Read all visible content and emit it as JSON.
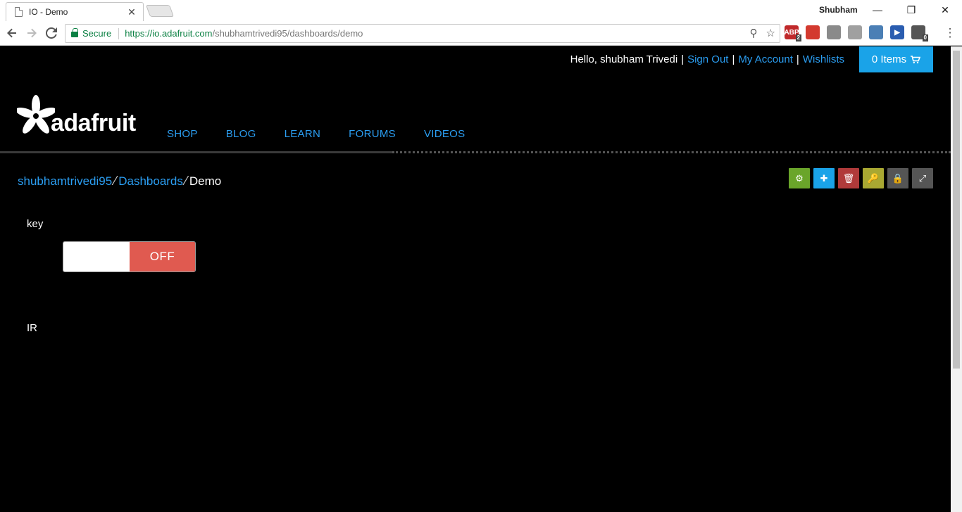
{
  "browser": {
    "tab_title": "IO - Demo",
    "tab_close": "✕",
    "profile_name": "Shubham",
    "minimize": "—",
    "restore": "❐",
    "close": "✕",
    "secure_label": "Secure",
    "url_host": "https://io.adafruit.com",
    "url_path": "/shubhamtrivedi95/dashboards/demo",
    "extensions": [
      {
        "name": "abp",
        "label": "ABP",
        "badge": "2",
        "color": "#c0282a"
      },
      {
        "name": "book",
        "label": "",
        "badge": "",
        "color": "#d33a2f"
      },
      {
        "name": "copy",
        "label": "",
        "badge": "",
        "color": "#8a8a8a"
      },
      {
        "name": "pdf",
        "label": "",
        "badge": "",
        "color": "#a0a0a0"
      },
      {
        "name": "photo",
        "label": "",
        "badge": "",
        "color": "#4b7fb5"
      },
      {
        "name": "play",
        "label": "▶",
        "badge": "",
        "color": "#2a5db0"
      },
      {
        "name": "trash",
        "label": "",
        "badge": "0",
        "color": "#555555"
      }
    ]
  },
  "header": {
    "greeting": "Hello, shubham Trivedi",
    "sign_out": "Sign Out",
    "my_account": "My Account",
    "wishlists": "Wishlists",
    "separator": "|",
    "cart_label": "0 Items",
    "cart_icon": "🛒"
  },
  "logo": {
    "text": "adafruit"
  },
  "nav": {
    "items": [
      "SHOP",
      "BLOG",
      "LEARN",
      "FORUMS",
      "VIDEOS"
    ]
  },
  "breadcrumb": {
    "user": "shubhamtrivedi95",
    "dashboards": "Dashboards",
    "current": "Demo",
    "separator": "⁄"
  },
  "actions": [
    {
      "name": "settings",
      "icon": "⚙",
      "color": "#6aa52a"
    },
    {
      "name": "add-block",
      "icon": "✚",
      "color": "#1aa3e8"
    },
    {
      "name": "delete",
      "icon": "🗑",
      "color": "#b03a3a"
    },
    {
      "name": "key",
      "icon": "🔑",
      "color": "#a9a832"
    },
    {
      "name": "lock",
      "icon": "🔒",
      "color": "#555555"
    },
    {
      "name": "fullscreen",
      "icon": "⤢",
      "color": "#555555"
    }
  ],
  "blocks": {
    "key_title": "key",
    "toggle_state": "OFF",
    "ir_title": "IR"
  }
}
